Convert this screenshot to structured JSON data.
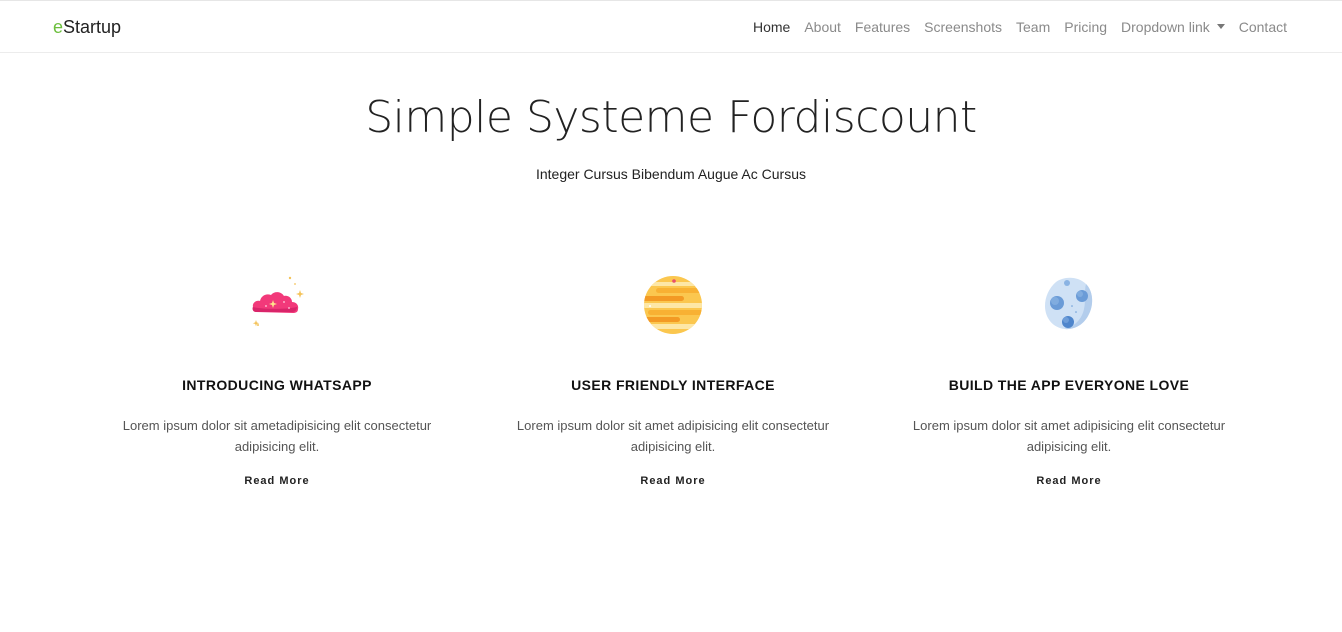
{
  "brand": {
    "prefix": "e",
    "rest": "Startup",
    "accent_color": "#6cbf3d"
  },
  "nav": {
    "items": [
      {
        "label": "Home",
        "active": true
      },
      {
        "label": "About"
      },
      {
        "label": "Features"
      },
      {
        "label": "Screenshots"
      },
      {
        "label": "Team"
      },
      {
        "label": "Pricing"
      },
      {
        "label": "Dropdown link"
      },
      {
        "label": "Contact"
      }
    ]
  },
  "hero": {
    "title": "Simple Systeme Fordiscount",
    "subtitle": "Integer Cursus Bibendum Augue Ac Cursus"
  },
  "features": [
    {
      "icon": "pink-cloud-icon",
      "title": "INTRODUCING WHATSAPP",
      "text": "Lorem ipsum dolor sit ametadipisicing elit consectetur adipisicing elit.",
      "link": "Read More"
    },
    {
      "icon": "orange-planet-icon",
      "title": "USER FRIENDLY INTERFACE",
      "text": "Lorem ipsum dolor sit amet adipisicing elit consectetur adipisicing elit.",
      "link": "Read More"
    },
    {
      "icon": "blue-moon-icon",
      "title": "BUILD THE APP EVERYONE LOVE",
      "text": "Lorem ipsum dolor sit amet adipisicing elit consectetur adipisicing elit.",
      "link": "Read More"
    }
  ]
}
